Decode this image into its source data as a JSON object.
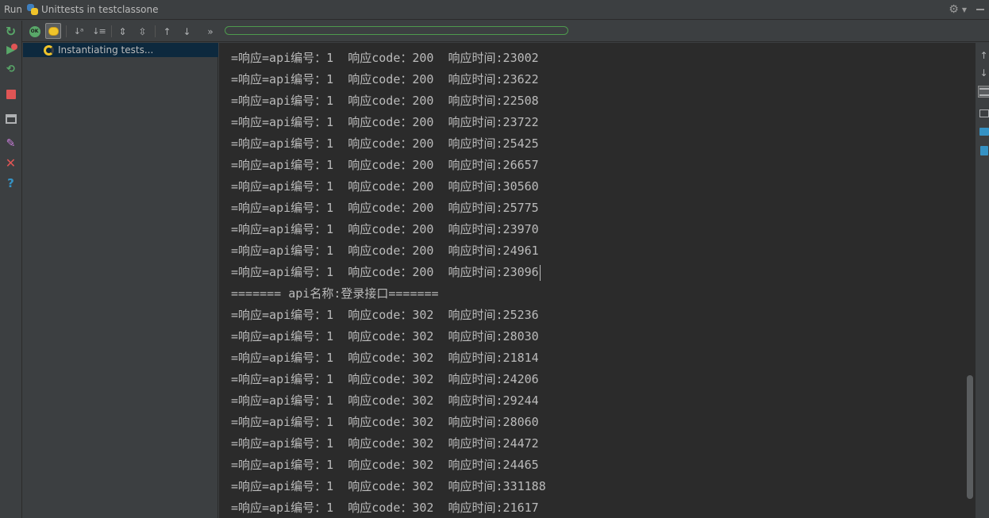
{
  "titlebar": {
    "run_label": "Run",
    "config_icon": "python-icon",
    "config_name": "Unittests in testclassone",
    "settings_icon": "gear-icon",
    "hide_icon": "minimize-icon"
  },
  "left_toolbar": {
    "items": [
      "rerun-icon",
      "rerun-failed-icon",
      "toggle-auto-test-icon",
      "stop-icon",
      "restore-layout-icon",
      "pin-tab-icon",
      "close-icon",
      "help-icon"
    ]
  },
  "test_toolbar": {
    "items": [
      "show-passed-icon",
      "show-ignored-icon",
      "sort-alphabetically-icon",
      "sort-by-duration-icon",
      "expand-all-icon",
      "collapse-all-icon",
      "previous-failed-icon",
      "next-failed-icon",
      "more-icon"
    ],
    "ok_label": "OK",
    "more_label": "»",
    "progress_fraction": 0
  },
  "test_tree": {
    "items": [
      {
        "label": "Instantiating tests...",
        "icon": "spinner-icon",
        "selected": true
      }
    ]
  },
  "console": {
    "lines": [
      "=响应=api编号：1  响应code：200  响应时间:23002",
      "=响应=api编号：1  响应code：200  响应时间:23622",
      "=响应=api编号：1  响应code：200  响应时间:22508",
      "=响应=api编号：1  响应code：200  响应时间:23722",
      "=响应=api编号：1  响应code：200  响应时间:25425",
      "=响应=api编号：1  响应code：200  响应时间:26657",
      "=响应=api编号：1  响应code：200  响应时间:30560",
      "=响应=api编号：1  响应code：200  响应时间:25775",
      "=响应=api编号：1  响应code：200  响应时间:23970",
      "=响应=api编号：1  响应code：200  响应时间:24961",
      "=响应=api编号：1  响应code：200  响应时间:23096",
      "======= api名称:登录接口=======",
      "=响应=api编号：1  响应code：302  响应时间:25236",
      "=响应=api编号：1  响应code：302  响应时间:28030",
      "=响应=api编号：1  响应code：302  响应时间:21814",
      "=响应=api编号：1  响应code：302  响应时间:24206",
      "=响应=api编号：1  响应code：302  响应时间:29244",
      "=响应=api编号：1  响应code：302  响应时间:28060",
      "=响应=api编号：1  响应code：302  响应时间:24472",
      "=响应=api编号：1  响应code：302  响应时间:24465",
      "=响应=api编号：1  响应code：302  响应时间:331188",
      "=响应=api编号：1  响应code：302  响应时间:21617"
    ],
    "caret_line": 10
  },
  "right_toolbar": {
    "items": [
      "up-arrow-icon",
      "down-arrow-icon",
      "soft-wrap-icon",
      "scroll-to-end-icon",
      "print-icon",
      "clear-all-icon"
    ]
  },
  "colors": {
    "panel_bg": "#3c3f41",
    "console_bg": "#2b2b2b",
    "text": "#bbbbbb",
    "selection": "#0d293e",
    "progress_border": "#4e9a4e"
  }
}
